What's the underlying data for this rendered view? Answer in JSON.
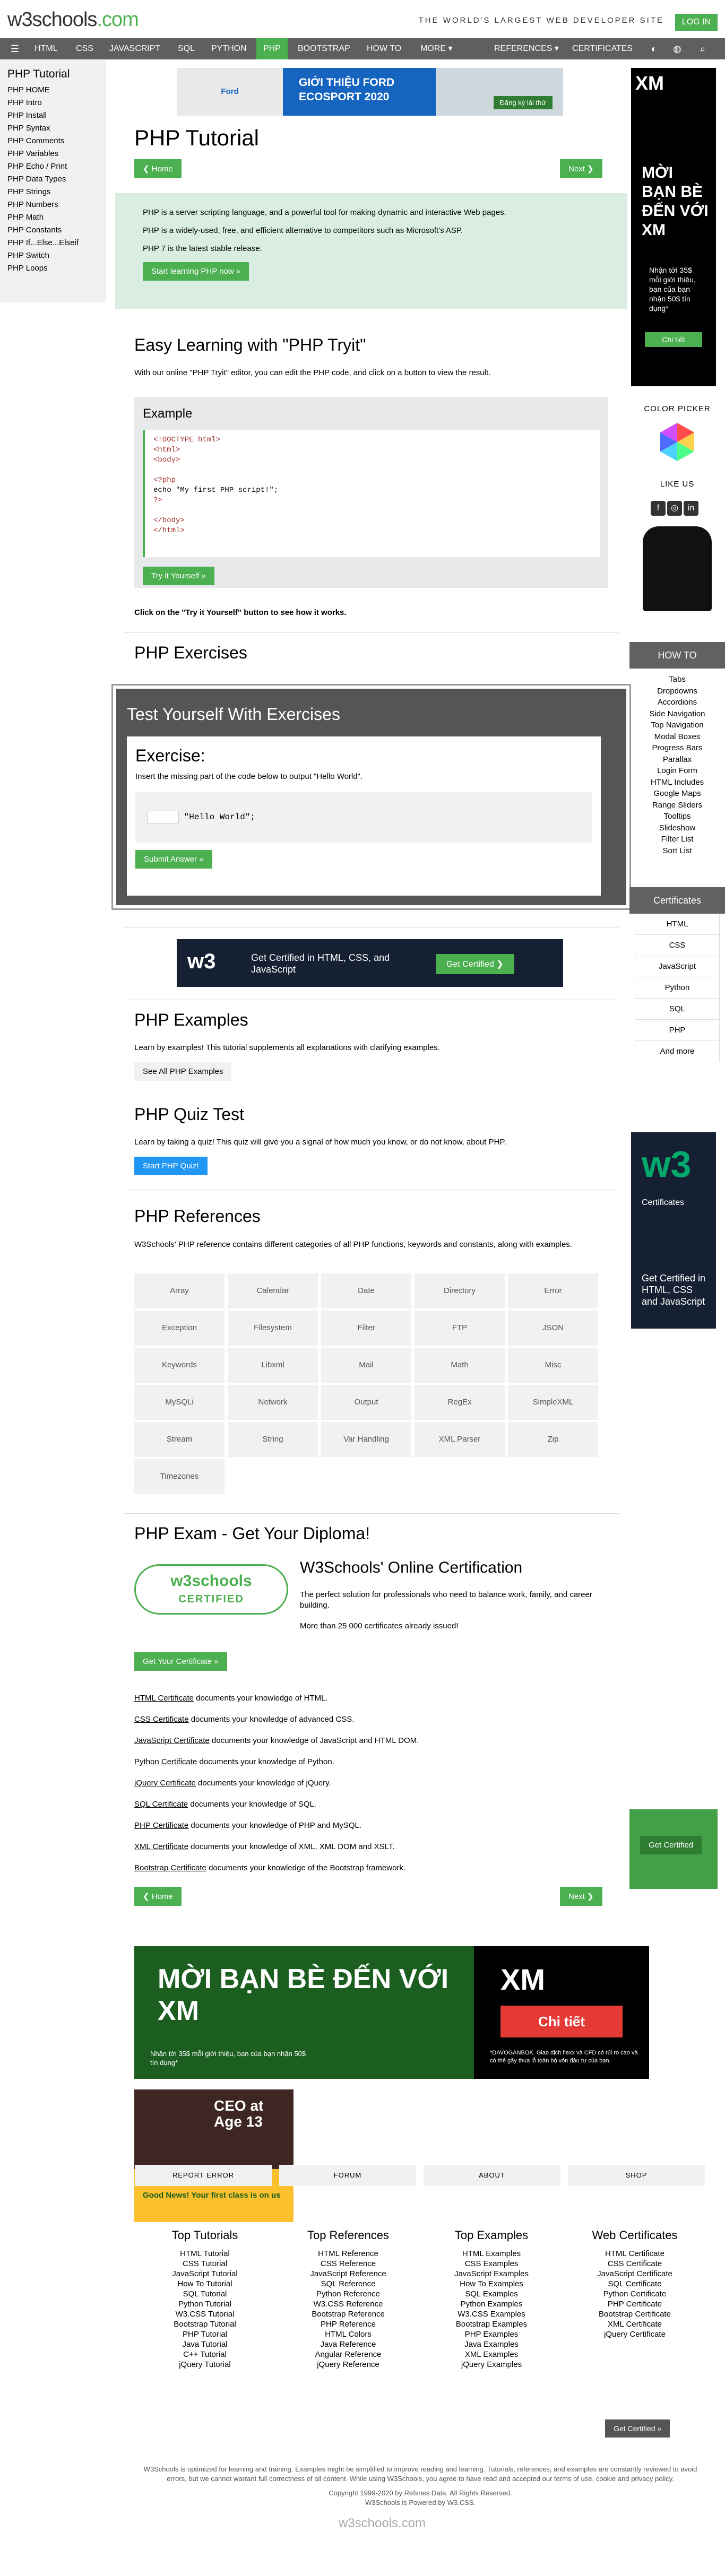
{
  "header": {
    "logo": "w3schools",
    "logo_tld": ".com",
    "slogan": "THE WORLD'S LARGEST WEB DEVELOPER SITE",
    "login": "LOG IN"
  },
  "topnav": {
    "items": [
      "HTML",
      "CSS",
      "JAVASCRIPT",
      "SQL",
      "PYTHON",
      "PHP",
      "BOOTSTRAP",
      "HOW TO",
      "MORE ▾"
    ],
    "right": [
      "REFERENCES ▾",
      "CERTIFICATES"
    ]
  },
  "sidebar": {
    "title": "PHP Tutorial",
    "items": [
      "PHP HOME",
      "PHP Intro",
      "PHP Install",
      "PHP Syntax",
      "PHP Comments",
      "PHP Variables",
      "PHP Echo / Print",
      "PHP Data Types",
      "PHP Strings",
      "PHP Numbers",
      "PHP Math",
      "PHP Constants",
      "PHP If...Else...Elseif",
      "PHP Switch",
      "PHP Loops"
    ]
  },
  "ads": {
    "top_left": "Ford",
    "top_text": "GIỚI THIỆU FORD ECOSPORT 2020",
    "top_cta": "Đăng ký lái thử",
    "mid_logo": "w3",
    "mid_text": "Get Certified in HTML, CSS, and JavaScript",
    "mid_cta": "Get Certified ❯",
    "xm_text": "MỜI BẠN BÈ ĐẾN VỚI XM",
    "xm_brand": "XM",
    "xm_cta": "Chi tiết",
    "xm_small": "Nhận tới 35$ mỗi giới thiệu, bạn của bạn nhận 50$ tín dụng*",
    "xm_disclaimer": "*DAVOGANBOK. Giao dịch fiexx và CFD có rủi ro cao và có thể gây thua lỗ toàn bộ vốn đầu tư của bạn.",
    "ceo_text": "CEO at Age 13",
    "ceo_sub": "Good News! Your first class is on us",
    "side_brand": "XM",
    "side_big": "MỜI BẠN BÈ ĐẾN VỚI XM",
    "side_text": "Nhận tới 35$ mỗi giới thiệu, bạn của bạn nhận 50$ tín dụng*",
    "side_cta": "Chi tiết",
    "side2_logo": "w3",
    "side2_sub": "Certificates",
    "side2_text": "Get Certified in HTML, CSS and JavaScript"
  },
  "main": {
    "title": "PHP Tutorial",
    "home": "❮ Home",
    "next": "Next ❯",
    "intro": [
      "PHP is a server scripting language, and a powerful tool for making dynamic and interactive Web pages.",
      "PHP is a widely-used, free, and efficient alternative to competitors such as Microsoft's ASP.",
      "PHP 7 is the latest stable release."
    ],
    "start_btn": "Start learning PHP now »",
    "easy_title": "Easy Learning with \"PHP Tryit\"",
    "easy_text": "With our online \"PHP Tryit\" editor, you can edit the PHP code, and click on a button to view the result.",
    "example_title": "Example",
    "code": [
      "<!DOCTYPE html>",
      "<html>",
      "<body>",
      "",
      "<?php",
      "echo \"My first PHP script!\";",
      "?>",
      "",
      "</body>",
      "</html>"
    ],
    "try_btn": "Try it Yourself »",
    "click_note": "Click on the \"Try it Yourself\" button to see how it works.",
    "exercises_title": "PHP Exercises",
    "test_title": "Test Yourself With Exercises",
    "exercise_title": "Exercise:",
    "exercise_text": "Insert the missing part of the code below to output \"Hello World\".",
    "exercise_code": "\"Hello World\";",
    "submit_btn": "Submit Answer »",
    "examples_title": "PHP Examples",
    "examples_text": "Learn by examples! This tutorial supplements all explanations with clarifying examples.",
    "examples_btn": "See All PHP Examples",
    "quiz_title": "PHP Quiz Test",
    "quiz_text": "Learn by taking a quiz! This quiz will give you a signal of how much you know, or do not know, about PHP.",
    "quiz_btn": "Start PHP Quiz!",
    "refs_title": "PHP References",
    "refs_text": "W3Schools' PHP reference contains different categories of all PHP functions, keywords and constants, along with examples.",
    "refs": [
      "Array",
      "Calendar",
      "Date",
      "Directory",
      "Error",
      "Exception",
      "Filesystem",
      "Filter",
      "FTP",
      "JSON",
      "Keywords",
      "Libxml",
      "Mail",
      "Math",
      "Misc",
      "MySQLi",
      "Network",
      "Output",
      "RegEx",
      "SimpleXML",
      "Stream",
      "String",
      "Var Handling",
      "XML Parser",
      "Zip",
      "Timezones"
    ],
    "exam_title": "PHP Exam - Get Your Diploma!",
    "cert_logo_1": "w3schools",
    "cert_logo_2": "CERTIFIED",
    "cert_title": "W3Schools' Online Certification",
    "cert_text": "The perfect solution for professionals who need to balance work, family, and career building.",
    "cert_count": "More than 25 000 certificates already issued!",
    "cert_btn": "Get Your Certificate »",
    "cert_lines": [
      {
        "link": "HTML Certificate",
        "rest": " documents your knowledge of HTML."
      },
      {
        "link": "CSS Certificate",
        "rest": " documents your knowledge of advanced CSS."
      },
      {
        "link": "JavaScript Certificate",
        "rest": " documents your knowledge of JavaScript and HTML DOM."
      },
      {
        "link": "Python Certificate",
        "rest": " documents your knowledge of Python."
      },
      {
        "link": "jQuery Certificate",
        "rest": " documents your knowledge of jQuery."
      },
      {
        "link": "SQL Certificate",
        "rest": " documents your knowledge of SQL."
      },
      {
        "link": "PHP Certificate",
        "rest": " documents your knowledge of PHP and MySQL."
      },
      {
        "link": "XML Certificate",
        "rest": " documents your knowledge of XML, XML DOM and XSLT."
      },
      {
        "link": "Bootstrap Certificate",
        "rest": " documents your knowledge of the Bootstrap framework."
      }
    ]
  },
  "right": {
    "color_picker": "COLOR PICKER",
    "like_us": "LIKE US",
    "howto_title": "HOW TO",
    "howto": [
      "Tabs",
      "Dropdowns",
      "Accordions",
      "Side Navigation",
      "Top Navigation",
      "Modal Boxes",
      "Progress Bars",
      "Parallax",
      "Login Form",
      "HTML Includes",
      "Google Maps",
      "Range Sliders",
      "Tooltips",
      "Slideshow",
      "Filter List",
      "Sort List"
    ],
    "cert_title": "Certificates",
    "certs": [
      "HTML",
      "CSS",
      "JavaScript",
      "Python",
      "SQL",
      "PHP",
      "And more"
    ],
    "shop_cta": "Get Certified"
  },
  "footer": {
    "tabs": [
      "REPORT ERROR",
      "FORUM",
      "ABOUT",
      "SHOP"
    ],
    "cols": [
      {
        "title": "Top Tutorials",
        "items": [
          "HTML Tutorial",
          "CSS Tutorial",
          "JavaScript Tutorial",
          "How To Tutorial",
          "SQL Tutorial",
          "Python Tutorial",
          "W3.CSS Tutorial",
          "Bootstrap Tutorial",
          "PHP Tutorial",
          "Java Tutorial",
          "C++ Tutorial",
          "jQuery Tutorial"
        ]
      },
      {
        "title": "Top References",
        "items": [
          "HTML Reference",
          "CSS Reference",
          "JavaScript Reference",
          "SQL Reference",
          "Python Reference",
          "W3.CSS Reference",
          "Bootstrap Reference",
          "PHP Reference",
          "HTML Colors",
          "Java Reference",
          "Angular Reference",
          "jQuery Reference"
        ]
      },
      {
        "title": "Top Examples",
        "items": [
          "HTML Examples",
          "CSS Examples",
          "JavaScript Examples",
          "How To Examples",
          "SQL Examples",
          "Python Examples",
          "W3.CSS Examples",
          "Bootstrap Examples",
          "PHP Examples",
          "Java Examples",
          "XML Examples",
          "jQuery Examples"
        ]
      },
      {
        "title": "Web Certificates",
        "items": [
          "HTML Certificate",
          "CSS Certificate",
          "JavaScript Certificate",
          "SQL Certificate",
          "Python Certificate",
          "PHP Certificate",
          "Bootstrap Certificate",
          "XML Certificate",
          "jQuery Certificate"
        ]
      }
    ],
    "get_certified": "Get Certified »",
    "note": "W3Schools is optimized for learning and training. Examples might be simplified to improve reading and learning. Tutorials, references, and examples are constantly reviewed to avoid errors, but we cannot warrant full correctness of all content. While using W3Schools, you agree to have read and accepted our terms of use, cookie and privacy policy.",
    "copyright": "Copyright 1999-2020 by Refsnes Data. All Rights Reserved.",
    "powered": "W3Schools is Powered by W3.CSS.",
    "logo": "w3schools.com"
  },
  "colors": {
    "accent": "#4CAF50",
    "nav": "#5f5f5f",
    "intro_bg": "#D9EEE1",
    "quiz": "#2196F3"
  }
}
